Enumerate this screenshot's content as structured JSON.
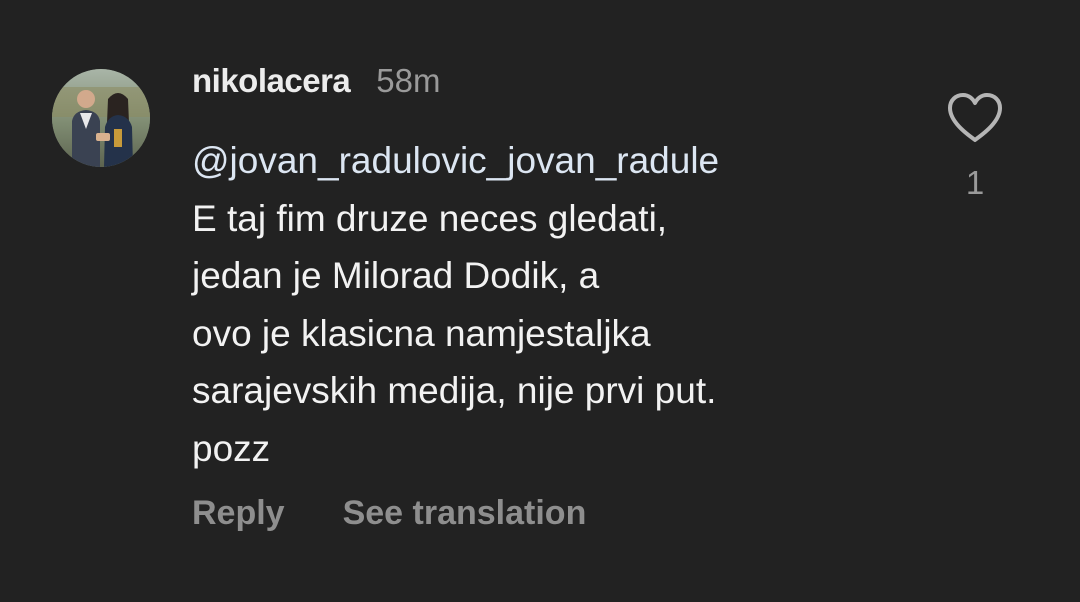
{
  "comment": {
    "username": "nikolacera",
    "timestamp": "58m",
    "mention": "@jovan_radulovic_jovan_radule",
    "lines": [
      "E taj fim druze neces gledati,",
      "jedan je Milorad Dodik, a",
      "ovo je klasicna namjestaljka",
      "sarajevskih medija, nije prvi put.",
      "pozz"
    ],
    "like_count": "1",
    "like_icon": "heart-outline-icon"
  },
  "actions": {
    "reply_label": "Reply",
    "translate_label": "See translation"
  },
  "colors": {
    "background": "#222222",
    "username": "#ececec",
    "body": "#f2f2f2",
    "secondary": "#8e8e8e"
  }
}
